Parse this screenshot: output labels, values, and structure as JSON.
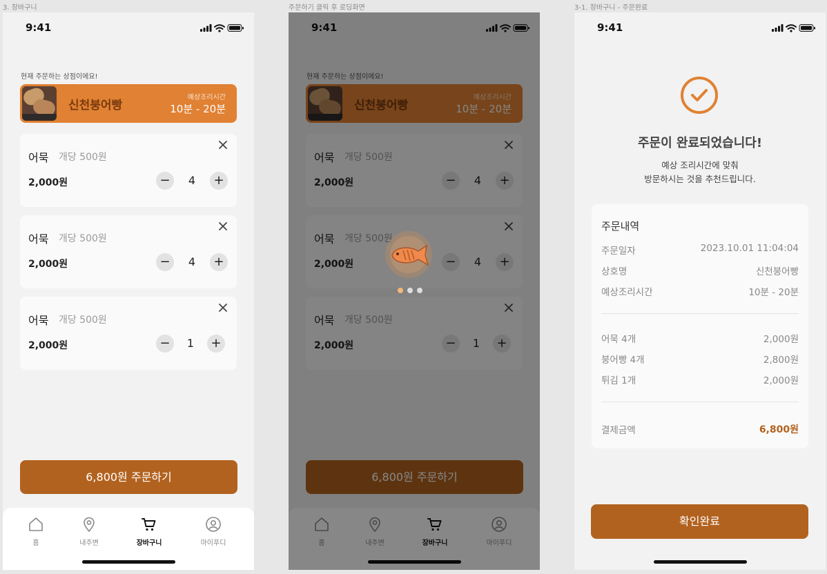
{
  "labels": {
    "frame1": "3. 장바구니",
    "frame2": "주문하기 클릭 후 로딩화면",
    "frame3": "3-1. 장바구니 - 주문완료"
  },
  "status": {
    "time": "9:41"
  },
  "cart": {
    "notice": "현재 주문하는 상점이에요!",
    "store_name": "신천붕어빵",
    "eta_label": "예상조리시간",
    "eta": "10분 - 20분",
    "items": [
      {
        "name": "어묵",
        "unit": "개당 500원",
        "price": "2,000원",
        "qty": "4",
        "minus": "−",
        "plus": "+"
      },
      {
        "name": "어묵",
        "unit": "개당 500원",
        "price": "2,000원",
        "qty": "4",
        "minus": "−",
        "plus": "+"
      },
      {
        "name": "어묵",
        "unit": "개당 500원",
        "price": "2,000원",
        "qty": "1",
        "minus": "−",
        "plus": "+"
      }
    ],
    "order_button": "6,800원 주문하기"
  },
  "tabs": [
    {
      "label": "홈",
      "icon": "home-icon"
    },
    {
      "label": "내주변",
      "icon": "map-pin-icon"
    },
    {
      "label": "장바구니",
      "icon": "cart-icon",
      "active": true
    },
    {
      "label": "마이푸디",
      "icon": "user-icon"
    }
  ],
  "complete": {
    "title": "주문이 완료되었습니다!",
    "sub1": "예상 조리시간에 맞춰",
    "sub2": "방문하시는 것을 추천드립니다.",
    "receipt_title": "주문내역",
    "info": [
      {
        "label": "주문일자",
        "value": "2023.10.01  11:04:04"
      },
      {
        "label": "상호명",
        "value": "신천붕어빵"
      },
      {
        "label": "예상조리시간",
        "value": "10분 - 20분"
      }
    ],
    "items": [
      {
        "label": "어묵 4개",
        "value": "2,000원"
      },
      {
        "label": "붕어빵 4개",
        "value": "2,800원"
      },
      {
        "label": "튀김 1개",
        "value": "2,000원"
      }
    ],
    "total_label": "결제금액",
    "total_value": "6,800원",
    "confirm_button": "확인완료"
  },
  "colors": {
    "accent": "#b2621f",
    "store_banner": "#e08133",
    "store_name": "#7a3a0c"
  }
}
